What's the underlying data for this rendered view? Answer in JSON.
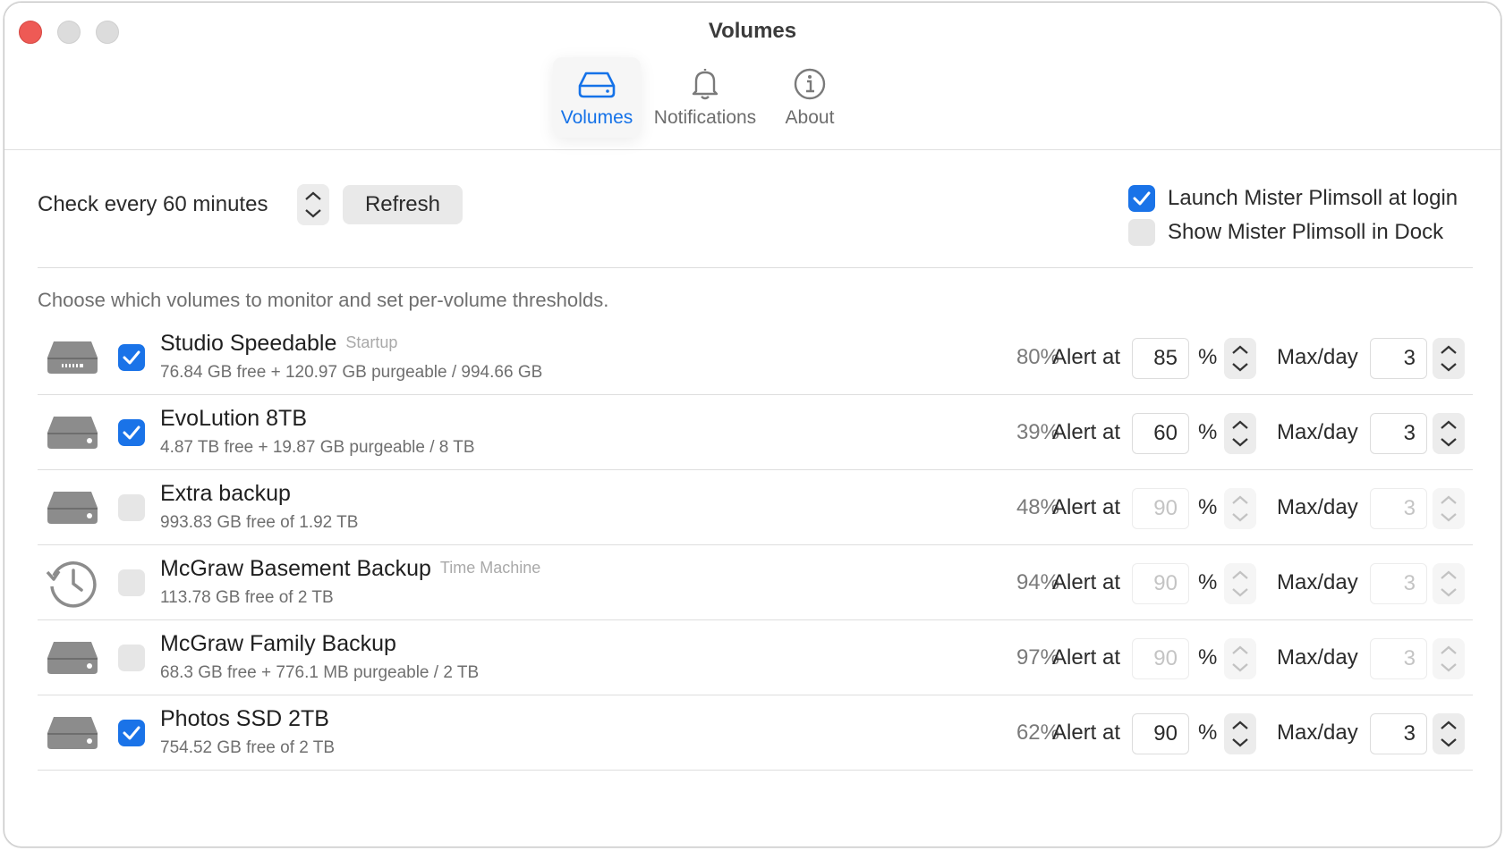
{
  "window": {
    "title": "Volumes"
  },
  "tabs": [
    {
      "label": "Volumes",
      "icon": "drive-icon",
      "active": true
    },
    {
      "label": "Notifications",
      "icon": "bell-icon",
      "active": false
    },
    {
      "label": "About",
      "icon": "info-icon",
      "active": false
    }
  ],
  "settings": {
    "check_interval_label": "Check every 60 minutes",
    "refresh_label": "Refresh",
    "launch_at_login": {
      "label": "Launch Mister Plimsoll at login",
      "checked": true
    },
    "show_in_dock": {
      "label": "Show Mister Plimsoll in Dock",
      "checked": false
    }
  },
  "hint": "Choose which volumes to monitor and set per-volume thresholds.",
  "colors": {
    "accent": "#1a73e8",
    "close": "#ee5a55",
    "tab_active": "#1572e8"
  },
  "volumes": [
    {
      "name": "Studio Speedable",
      "tag": "Startup",
      "detail": "76.84 GB free + 120.97 GB purgeable / 994.66 GB",
      "icon": "internal-drive-icon",
      "monitored": true,
      "used": "80%",
      "alert_label": "Alert at",
      "alert_value": "85",
      "percent": "%",
      "max_label": "Max/day",
      "max_value": "3"
    },
    {
      "name": "EvoLution 8TB",
      "tag": "",
      "detail": "4.87 TB free + 19.87 GB purgeable / 8 TB",
      "icon": "external-drive-icon",
      "monitored": true,
      "used": "39%",
      "alert_label": "Alert at",
      "alert_value": "60",
      "percent": "%",
      "max_label": "Max/day",
      "max_value": "3"
    },
    {
      "name": "Extra backup",
      "tag": "",
      "detail": "993.83 GB free of 1.92 TB",
      "icon": "external-drive-icon",
      "monitored": false,
      "used": "48%",
      "alert_label": "Alert at",
      "alert_value": "90",
      "percent": "%",
      "max_label": "Max/day",
      "max_value": "3"
    },
    {
      "name": "McGraw Basement Backup",
      "tag": "Time Machine",
      "detail": "113.78 GB free of 2 TB",
      "icon": "time-machine-icon",
      "monitored": false,
      "used": "94%",
      "alert_label": "Alert at",
      "alert_value": "90",
      "percent": "%",
      "max_label": "Max/day",
      "max_value": "3"
    },
    {
      "name": "McGraw Family Backup",
      "tag": "",
      "detail": "68.3 GB free + 776.1 MB purgeable / 2 TB",
      "icon": "external-drive-icon",
      "monitored": false,
      "used": "97%",
      "alert_label": "Alert at",
      "alert_value": "90",
      "percent": "%",
      "max_label": "Max/day",
      "max_value": "3"
    },
    {
      "name": "Photos SSD 2TB",
      "tag": "",
      "detail": "754.52 GB free of 2 TB",
      "icon": "external-drive-icon",
      "monitored": true,
      "used": "62%",
      "alert_label": "Alert at",
      "alert_value": "90",
      "percent": "%",
      "max_label": "Max/day",
      "max_value": "3"
    }
  ]
}
